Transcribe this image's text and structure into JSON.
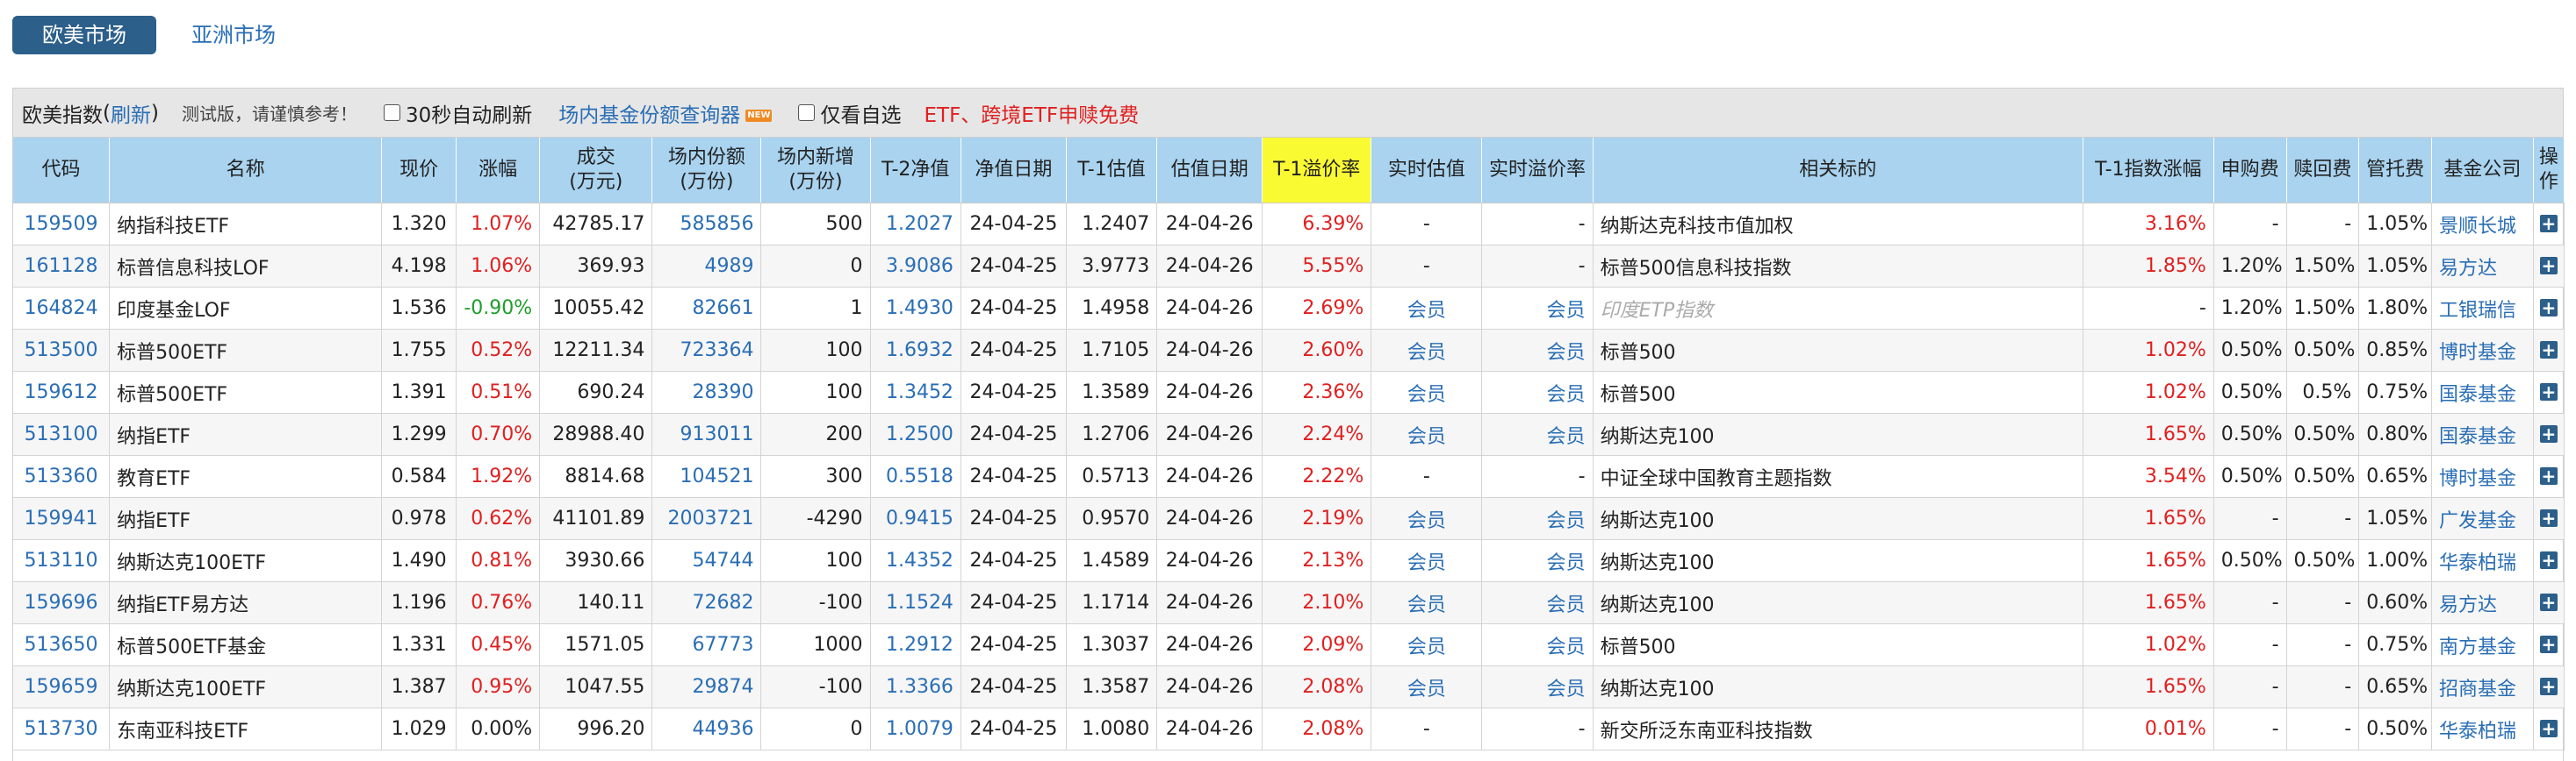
{
  "tabs": [
    {
      "label": "欧美市场",
      "active": true
    },
    {
      "label": "亚洲市场",
      "active": false
    }
  ],
  "toolbar": {
    "title": "欧美指数",
    "refresh": "刷新",
    "note": "测试版，请谨慎参考！",
    "auto_refresh": "30秒自动刷新",
    "query_link": "场内基金份额查询器",
    "new_badge": "NEW",
    "watchlist": "仅看自选",
    "promo": "ETF、跨境ETF申赎免费"
  },
  "headers": [
    {
      "l1": "代码",
      "l2": ""
    },
    {
      "l1": "名称",
      "l2": ""
    },
    {
      "l1": "现价",
      "l2": ""
    },
    {
      "l1": "涨幅",
      "l2": ""
    },
    {
      "l1": "成交",
      "l2": "(万元)"
    },
    {
      "l1": "场内份额",
      "l2": "(万份)"
    },
    {
      "l1": "场内新增",
      "l2": "(万份)"
    },
    {
      "l1": "T-2净值",
      "l2": ""
    },
    {
      "l1": "净值日期",
      "l2": ""
    },
    {
      "l1": "T-1估值",
      "l2": ""
    },
    {
      "l1": "估值日期",
      "l2": ""
    },
    {
      "l1": "T-1溢价率",
      "l2": ""
    },
    {
      "l1": "实时估值",
      "l2": ""
    },
    {
      "l1": "实时溢价率",
      "l2": ""
    },
    {
      "l1": "相关标的",
      "l2": ""
    },
    {
      "l1": "T-1指数涨幅",
      "l2": ""
    },
    {
      "l1": "申购费",
      "l2": ""
    },
    {
      "l1": "赎回费",
      "l2": ""
    },
    {
      "l1": "管托费",
      "l2": ""
    },
    {
      "l1": "基金公司",
      "l2": ""
    },
    {
      "l1": "操",
      "l2": "作"
    }
  ],
  "action_icon": "plus-icon",
  "colors": {
    "up": "#e02020",
    "down": "#1f9e2a",
    "link": "#2a6eb5",
    "header": "#a9d3ef",
    "highlight": "#fafa33",
    "tab": "#2c5f8a"
  },
  "rows": [
    {
      "code": "159509",
      "name": "纳指科技ETF",
      "price": "1.320",
      "chg": "1.07%",
      "chg_dir": "up",
      "vol": "42785.17",
      "shares": "585856",
      "new_shares": "500",
      "nav": "1.2027",
      "nav_date": "24-04-25",
      "est": "1.2407",
      "est_date": "24-04-26",
      "premium": "6.39%",
      "rt_est": "-",
      "rt_premium": "-",
      "target": "纳斯达克科技市值加权",
      "target_muted": false,
      "idx_chg": "3.16%",
      "idx_dir": "up",
      "sub_fee": "-",
      "red_fee": "-",
      "mgmt_fee": "1.05%",
      "company": "景顺长城"
    },
    {
      "code": "161128",
      "name": "标普信息科技LOF",
      "price": "4.198",
      "chg": "1.06%",
      "chg_dir": "up",
      "vol": "369.93",
      "shares": "4989",
      "new_shares": "0",
      "nav": "3.9086",
      "nav_date": "24-04-25",
      "est": "3.9773",
      "est_date": "24-04-26",
      "premium": "5.55%",
      "rt_est": "-",
      "rt_premium": "-",
      "target": "标普500信息科技指数",
      "target_muted": false,
      "idx_chg": "1.85%",
      "idx_dir": "up",
      "sub_fee": "1.20%",
      "red_fee": "1.50%",
      "mgmt_fee": "1.05%",
      "company": "易方达"
    },
    {
      "code": "164824",
      "name": "印度基金LOF",
      "price": "1.536",
      "chg": "-0.90%",
      "chg_dir": "down",
      "vol": "10055.42",
      "shares": "82661",
      "new_shares": "1",
      "nav": "1.4930",
      "nav_date": "24-04-25",
      "est": "1.4958",
      "est_date": "24-04-26",
      "premium": "2.69%",
      "rt_est": "会员",
      "rt_premium": "会员",
      "target": "印度ETP指数",
      "target_muted": true,
      "idx_chg": "-",
      "idx_dir": "none",
      "sub_fee": "1.20%",
      "red_fee": "1.50%",
      "mgmt_fee": "1.80%",
      "company": "工银瑞信"
    },
    {
      "code": "513500",
      "name": "标普500ETF",
      "price": "1.755",
      "chg": "0.52%",
      "chg_dir": "up",
      "vol": "12211.34",
      "shares": "723364",
      "new_shares": "100",
      "nav": "1.6932",
      "nav_date": "24-04-25",
      "est": "1.7105",
      "est_date": "24-04-26",
      "premium": "2.60%",
      "rt_est": "会员",
      "rt_premium": "会员",
      "target": "标普500",
      "target_muted": false,
      "idx_chg": "1.02%",
      "idx_dir": "up",
      "sub_fee": "0.50%",
      "red_fee": "0.50%",
      "mgmt_fee": "0.85%",
      "company": "博时基金"
    },
    {
      "code": "159612",
      "name": "标普500ETF",
      "price": "1.391",
      "chg": "0.51%",
      "chg_dir": "up",
      "vol": "690.24",
      "shares": "28390",
      "new_shares": "100",
      "nav": "1.3452",
      "nav_date": "24-04-25",
      "est": "1.3589",
      "est_date": "24-04-26",
      "premium": "2.36%",
      "rt_est": "会员",
      "rt_premium": "会员",
      "target": "标普500",
      "target_muted": false,
      "idx_chg": "1.02%",
      "idx_dir": "up",
      "sub_fee": "0.50%",
      "red_fee": "0.5%",
      "mgmt_fee": "0.75%",
      "company": "国泰基金"
    },
    {
      "code": "513100",
      "name": "纳指ETF",
      "price": "1.299",
      "chg": "0.70%",
      "chg_dir": "up",
      "vol": "28988.40",
      "shares": "913011",
      "new_shares": "200",
      "nav": "1.2500",
      "nav_date": "24-04-25",
      "est": "1.2706",
      "est_date": "24-04-26",
      "premium": "2.24%",
      "rt_est": "会员",
      "rt_premium": "会员",
      "target": "纳斯达克100",
      "target_muted": false,
      "idx_chg": "1.65%",
      "idx_dir": "up",
      "sub_fee": "0.50%",
      "red_fee": "0.50%",
      "mgmt_fee": "0.80%",
      "company": "国泰基金"
    },
    {
      "code": "513360",
      "name": "教育ETF",
      "price": "0.584",
      "chg": "1.92%",
      "chg_dir": "up",
      "vol": "8814.68",
      "shares": "104521",
      "new_shares": "300",
      "nav": "0.5518",
      "nav_date": "24-04-25",
      "est": "0.5713",
      "est_date": "24-04-26",
      "premium": "2.22%",
      "rt_est": "-",
      "rt_premium": "-",
      "target": "中证全球中国教育主题指数",
      "target_muted": false,
      "idx_chg": "3.54%",
      "idx_dir": "up",
      "sub_fee": "0.50%",
      "red_fee": "0.50%",
      "mgmt_fee": "0.65%",
      "company": "博时基金"
    },
    {
      "code": "159941",
      "name": "纳指ETF",
      "price": "0.978",
      "chg": "0.62%",
      "chg_dir": "up",
      "vol": "41101.89",
      "shares": "2003721",
      "new_shares": "-4290",
      "nav": "0.9415",
      "nav_date": "24-04-25",
      "est": "0.9570",
      "est_date": "24-04-26",
      "premium": "2.19%",
      "rt_est": "会员",
      "rt_premium": "会员",
      "target": "纳斯达克100",
      "target_muted": false,
      "idx_chg": "1.65%",
      "idx_dir": "up",
      "sub_fee": "-",
      "red_fee": "-",
      "mgmt_fee": "1.05%",
      "company": "广发基金"
    },
    {
      "code": "513110",
      "name": "纳斯达克100ETF",
      "price": "1.490",
      "chg": "0.81%",
      "chg_dir": "up",
      "vol": "3930.66",
      "shares": "54744",
      "new_shares": "100",
      "nav": "1.4352",
      "nav_date": "24-04-25",
      "est": "1.4589",
      "est_date": "24-04-26",
      "premium": "2.13%",
      "rt_est": "会员",
      "rt_premium": "会员",
      "target": "纳斯达克100",
      "target_muted": false,
      "idx_chg": "1.65%",
      "idx_dir": "up",
      "sub_fee": "0.50%",
      "red_fee": "0.50%",
      "mgmt_fee": "1.00%",
      "company": "华泰柏瑞"
    },
    {
      "code": "159696",
      "name": "纳指ETF易方达",
      "price": "1.196",
      "chg": "0.76%",
      "chg_dir": "up",
      "vol": "140.11",
      "shares": "72682",
      "new_shares": "-100",
      "nav": "1.1524",
      "nav_date": "24-04-25",
      "est": "1.1714",
      "est_date": "24-04-26",
      "premium": "2.10%",
      "rt_est": "会员",
      "rt_premium": "会员",
      "target": "纳斯达克100",
      "target_muted": false,
      "idx_chg": "1.65%",
      "idx_dir": "up",
      "sub_fee": "-",
      "red_fee": "-",
      "mgmt_fee": "0.60%",
      "company": "易方达"
    },
    {
      "code": "513650",
      "name": "标普500ETF基金",
      "price": "1.331",
      "chg": "0.45%",
      "chg_dir": "up",
      "vol": "1571.05",
      "shares": "67773",
      "new_shares": "1000",
      "nav": "1.2912",
      "nav_date": "24-04-25",
      "est": "1.3037",
      "est_date": "24-04-26",
      "premium": "2.09%",
      "rt_est": "会员",
      "rt_premium": "会员",
      "target": "标普500",
      "target_muted": false,
      "idx_chg": "1.02%",
      "idx_dir": "up",
      "sub_fee": "-",
      "red_fee": "-",
      "mgmt_fee": "0.75%",
      "company": "南方基金"
    },
    {
      "code": "159659",
      "name": "纳斯达克100ETF",
      "price": "1.387",
      "chg": "0.95%",
      "chg_dir": "up",
      "vol": "1047.55",
      "shares": "29874",
      "new_shares": "-100",
      "nav": "1.3366",
      "nav_date": "24-04-25",
      "est": "1.3587",
      "est_date": "24-04-26",
      "premium": "2.08%",
      "rt_est": "会员",
      "rt_premium": "会员",
      "target": "纳斯达克100",
      "target_muted": false,
      "idx_chg": "1.65%",
      "idx_dir": "up",
      "sub_fee": "-",
      "red_fee": "-",
      "mgmt_fee": "0.65%",
      "company": "招商基金"
    },
    {
      "code": "513730",
      "name": "东南亚科技ETF",
      "price": "1.029",
      "chg": "0.00%",
      "chg_dir": "none",
      "vol": "996.20",
      "shares": "44936",
      "new_shares": "0",
      "nav": "1.0079",
      "nav_date": "24-04-25",
      "est": "1.0080",
      "est_date": "24-04-26",
      "premium": "2.08%",
      "rt_est": "-",
      "rt_premium": "-",
      "target": "新交所泛东南亚科技指数",
      "target_muted": false,
      "idx_chg": "0.01%",
      "idx_dir": "up",
      "sub_fee": "-",
      "red_fee": "-",
      "mgmt_fee": "0.50%",
      "company": "华泰柏瑞"
    }
  ]
}
